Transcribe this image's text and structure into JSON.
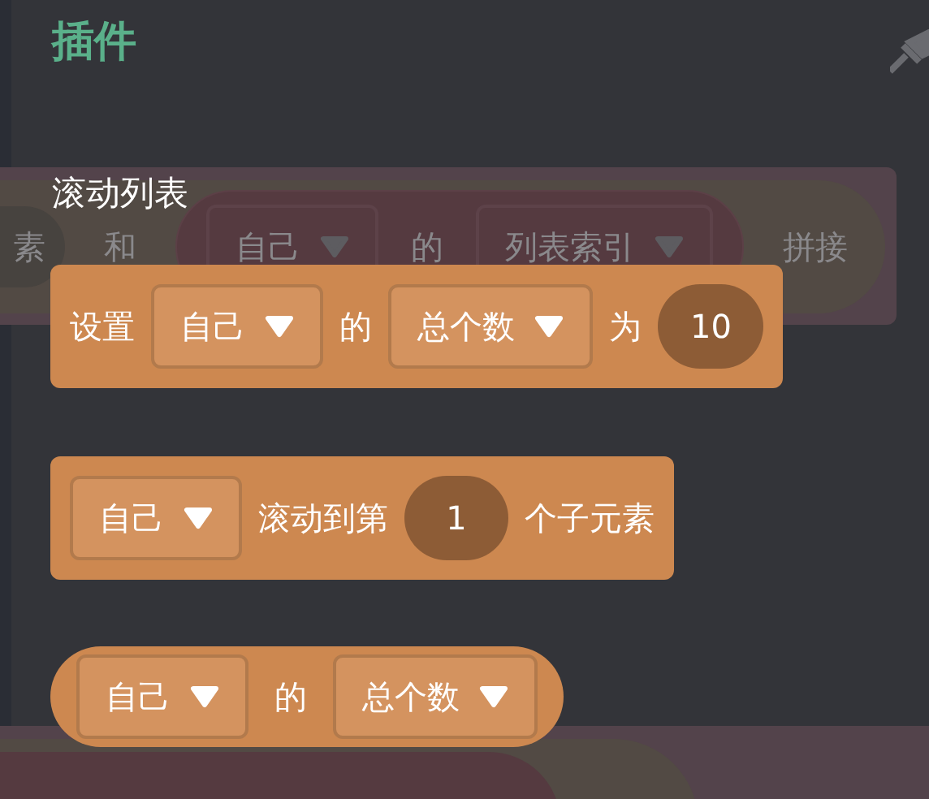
{
  "flyout": {
    "title": "插件",
    "section_label": "滚动列表",
    "blocks": [
      {
        "kind": "statement",
        "parts": [
          {
            "kind": "text",
            "text": "设置"
          },
          {
            "kind": "dropdown",
            "text": "自己"
          },
          {
            "kind": "text",
            "text": "的"
          },
          {
            "kind": "dropdown",
            "text": "总个数"
          },
          {
            "kind": "text",
            "text": "为"
          },
          {
            "kind": "number",
            "text": "10"
          }
        ]
      },
      {
        "kind": "statement",
        "parts": [
          {
            "kind": "dropdown",
            "text": "自己"
          },
          {
            "kind": "text",
            "text": "滚动到第"
          },
          {
            "kind": "number",
            "text": "1"
          },
          {
            "kind": "text",
            "text": "个子元素"
          }
        ]
      },
      {
        "kind": "reporter",
        "parts": [
          {
            "kind": "dropdown",
            "text": "自己"
          },
          {
            "kind": "text",
            "text": "的"
          },
          {
            "kind": "dropdown",
            "text": "总个数"
          }
        ]
      }
    ]
  },
  "workspace_block": {
    "left_text": "素",
    "joiner": "和",
    "inner_parts": [
      {
        "kind": "dropdown",
        "text": "自己"
      },
      {
        "kind": "text",
        "text": "的"
      },
      {
        "kind": "dropdown",
        "text": "列表索引"
      }
    ],
    "right_text": "拼接"
  }
}
